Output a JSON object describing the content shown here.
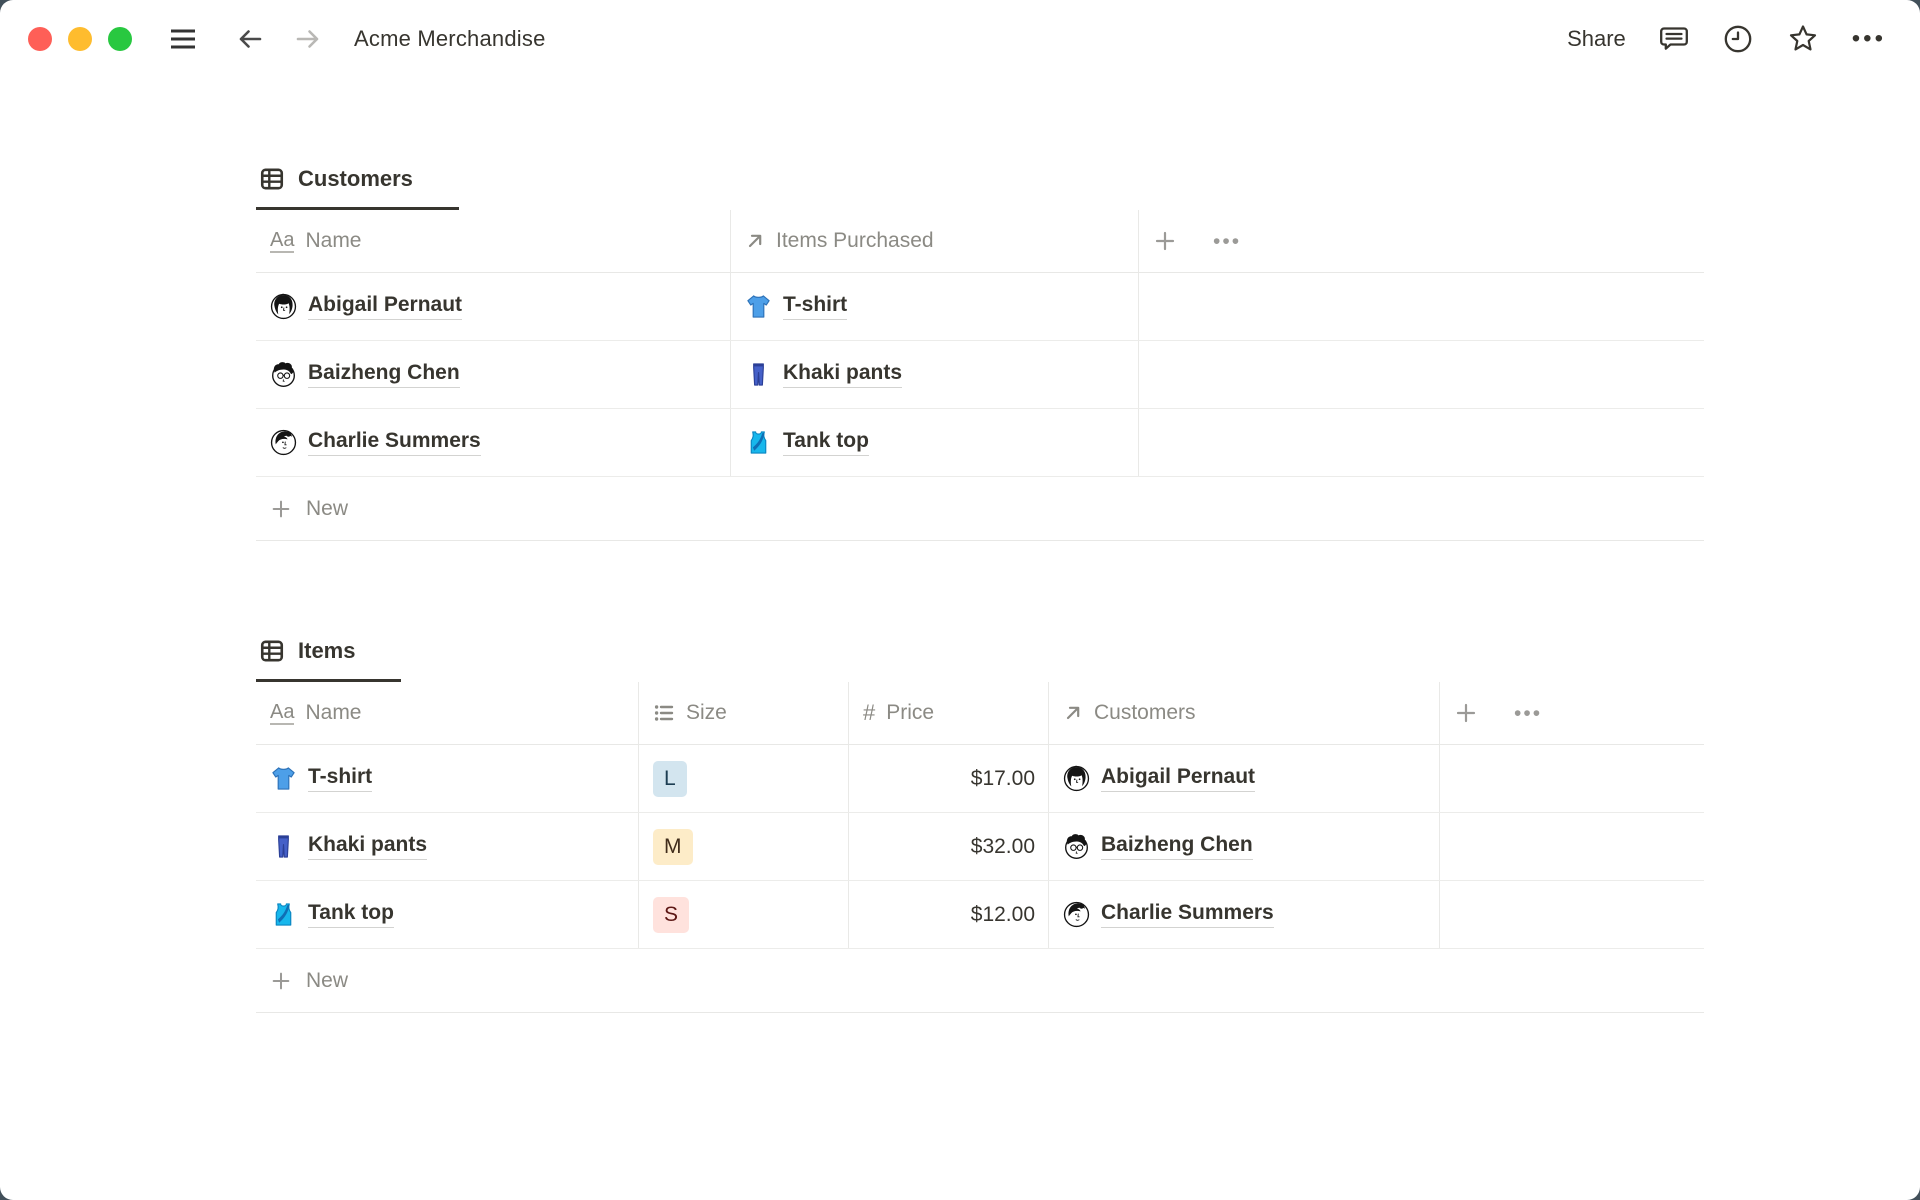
{
  "window": {
    "title": "Acme Merchandise",
    "share_label": "Share"
  },
  "icons": {
    "aa": "Aa",
    "hash": "#",
    "ellipsis": "•••"
  },
  "colors": {
    "backdrop": "#42505a",
    "accent_text": "#37352f",
    "badge_blue": "#d3e5ef",
    "badge_yellow": "#fdecc8",
    "badge_red": "#ffe2dd"
  },
  "customers_table": {
    "tab_label": "Customers",
    "columns": [
      {
        "label": "Name",
        "icon": "text-property-icon"
      },
      {
        "label": "Items Purchased",
        "icon": "relation-property-icon"
      }
    ],
    "rows": [
      {
        "name": "Abigail Pernaut",
        "avatar": "abigail-avatar",
        "item": "T-shirt",
        "item_icon": "tshirt-icon"
      },
      {
        "name": "Baizheng Chen",
        "avatar": "baizheng-avatar",
        "item": "Khaki pants",
        "item_icon": "jeans-icon"
      },
      {
        "name": "Charlie Summers",
        "avatar": "charlie-avatar",
        "item": "Tank top",
        "item_icon": "tanktop-icon"
      }
    ],
    "new_label": "New"
  },
  "items_table": {
    "tab_label": "Items",
    "columns": [
      {
        "label": "Name",
        "icon": "text-property-icon"
      },
      {
        "label": "Size",
        "icon": "select-property-icon"
      },
      {
        "label": "Price",
        "icon": "number-property-icon"
      },
      {
        "label": "Customers",
        "icon": "relation-property-icon"
      }
    ],
    "rows": [
      {
        "name": "T-shirt",
        "item_icon": "tshirt-icon",
        "size": "L",
        "size_color": "blue",
        "price": "$17.00",
        "customer": "Abigail Pernaut",
        "avatar": "abigail-avatar"
      },
      {
        "name": "Khaki pants",
        "item_icon": "jeans-icon",
        "size": "M",
        "size_color": "yellow",
        "price": "$32.00",
        "customer": "Baizheng Chen",
        "avatar": "baizheng-avatar"
      },
      {
        "name": "Tank top",
        "item_icon": "tanktop-icon",
        "size": "S",
        "size_color": "red",
        "price": "$12.00",
        "customer": "Charlie Summers",
        "avatar": "charlie-avatar"
      }
    ],
    "new_label": "New"
  }
}
